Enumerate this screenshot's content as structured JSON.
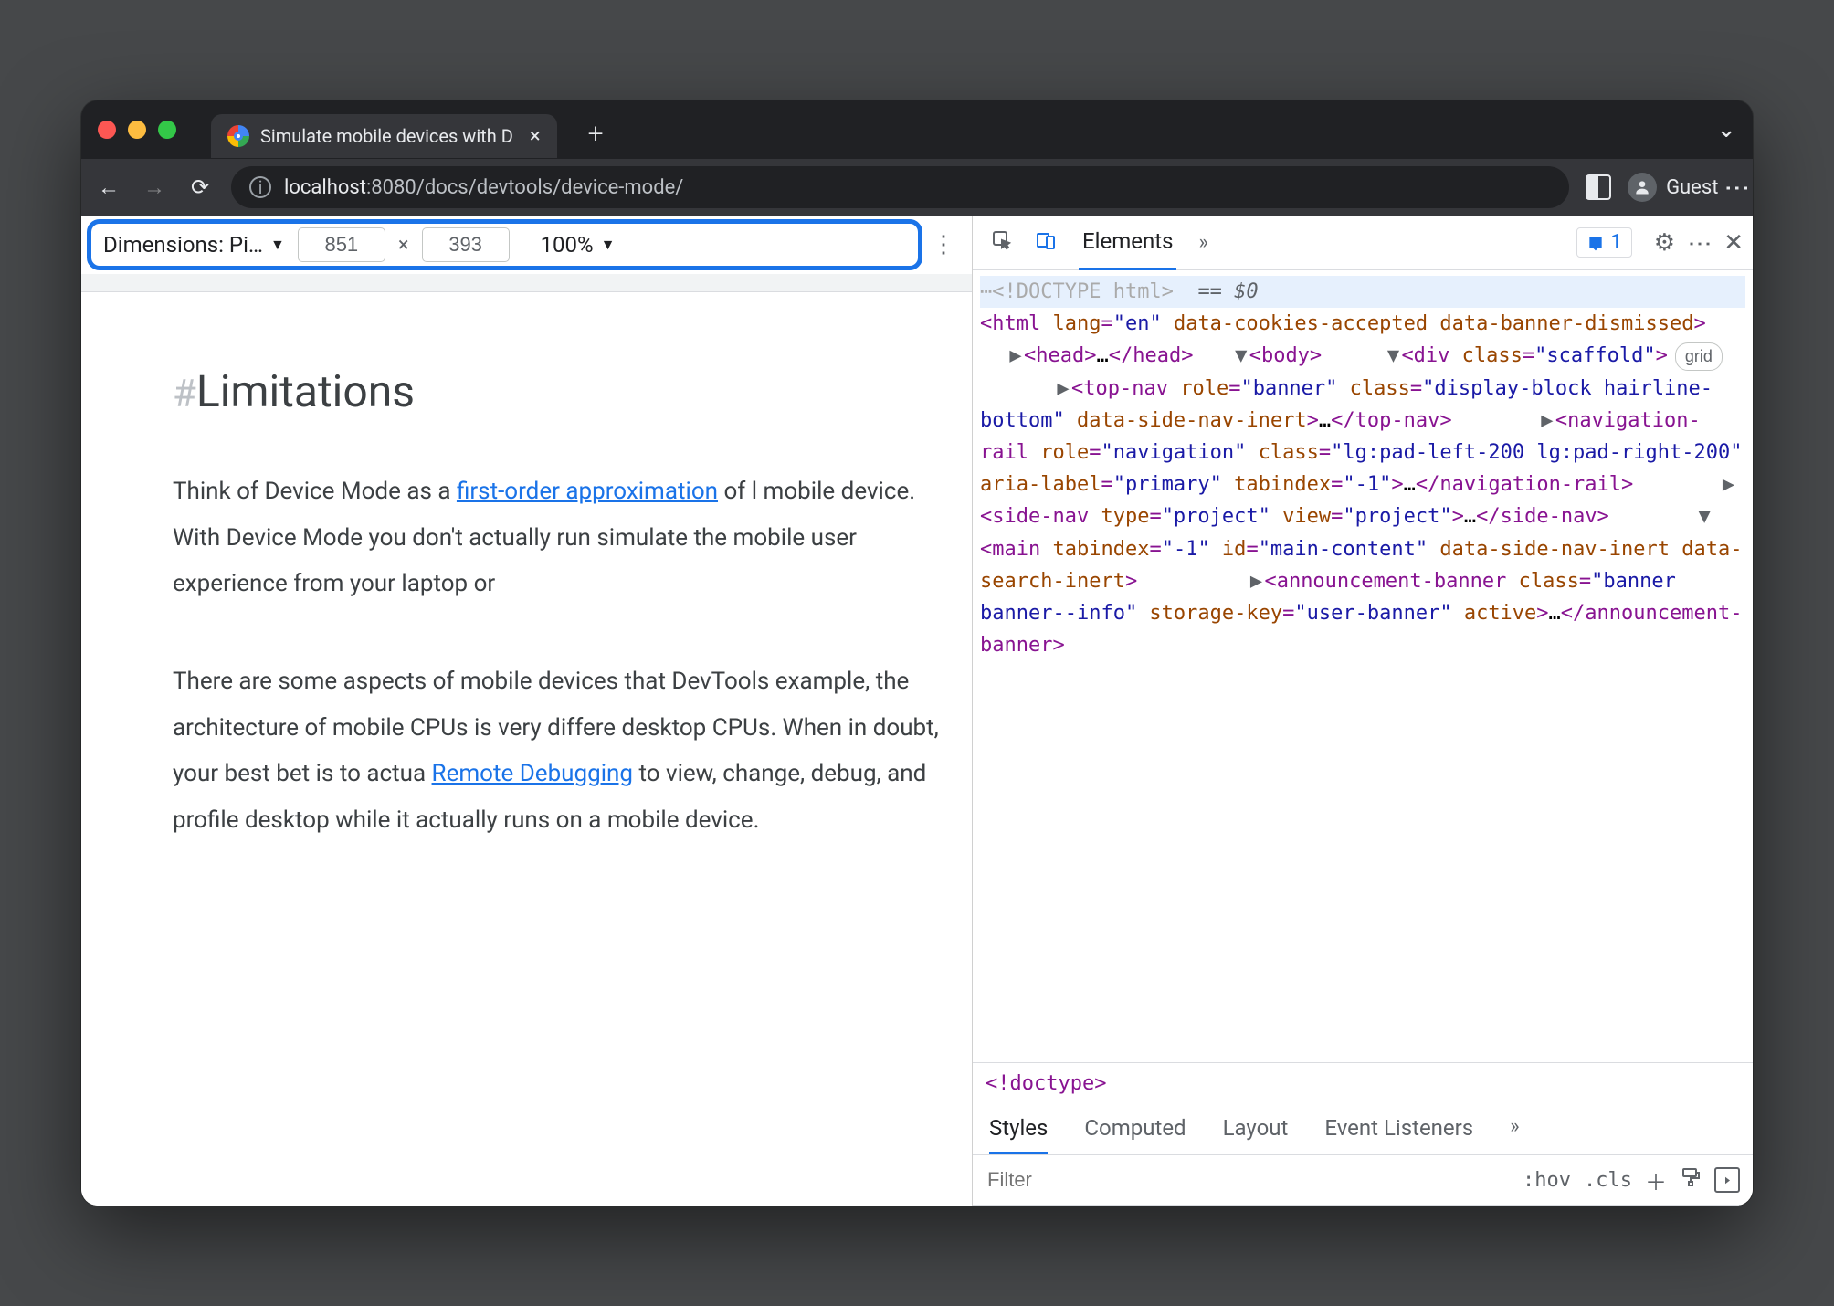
{
  "titlebar": {
    "tab_title": "Simulate mobile devices with D",
    "tab_close": "×",
    "new_tab": "+",
    "chevron": "⌄"
  },
  "addrbar": {
    "back": "←",
    "forward": "→",
    "reload": "⟳",
    "url_host": "localhost",
    "url_port_path": ":8080/docs/devtools/device-mode/",
    "guest_label": "Guest",
    "kebab": "⋮"
  },
  "device_toolbar": {
    "dimensions_label": "Dimensions: Pi…",
    "width": "851",
    "times": "×",
    "height": "393",
    "zoom": "100%",
    "kebab": "⋮"
  },
  "page": {
    "hash": "#",
    "heading": "Limitations",
    "p1_a": "Think of Device Mode as a ",
    "p1_link": "first-order approximation",
    "p1_b": " of l mobile device. With Device Mode you don't actually run simulate the mobile user experience from your laptop or",
    "p2_a": "There are some aspects of mobile devices that DevTools example, the architecture of mobile CPUs is very differe desktop CPUs. When in doubt, your best bet is to actua ",
    "p2_link": "Remote Debugging",
    "p2_b": " to view, change, debug, and profile desktop while it actually runs on a mobile device."
  },
  "devtools": {
    "elements_tab": "Elements",
    "more": "»",
    "issues_count": "1",
    "gear": "⚙",
    "kebab": "⋮",
    "close": "✕",
    "dom": {
      "l0": "<!DOCTYPE html>",
      "eq": "== $0",
      "l1_a": "<html ",
      "l1_attr1": "lang",
      "l1_val1": "\"en\"",
      "l1_attr2": " data-cookies-accepted data-banner-dismissed",
      "l1_c": ">",
      "l2_a": "<head>",
      "l2_b": "…",
      "l2_c": "</head>",
      "l3": "<body>",
      "l4_a": "<div ",
      "l4_attr": "class",
      "l4_val": "\"scaffold\"",
      "l4_c": ">",
      "l4_badge": "grid",
      "l5_a": "<top-nav ",
      "l5_attr1": "role",
      "l5_val1": "\"banner\"",
      "l5_attr2": " class",
      "l5_val2": "\"display-block hairline-bottom\"",
      "l5_attr3": " data-side-nav-inert",
      "l5_c": ">",
      "l5_d": "…",
      "l5_e": "</top-nav>",
      "l6_a": "<navigation-rail ",
      "l6_attr1": "role",
      "l6_val1": "\"navigation\"",
      "l6_attr2": " class",
      "l6_val2": "\"lg:pad-left-200 lg:pad-right-200\"",
      "l6_attr3": " aria-label",
      "l6_val3": "\"primary\"",
      "l6_attr4": " tabindex",
      "l6_val4": "\"-1\"",
      "l6_c": ">",
      "l6_d": "…",
      "l6_e": "</navigation-rail>",
      "l7_a": "<side-nav ",
      "l7_attr1": "type",
      "l7_val1": "\"project\"",
      "l7_attr2": " view",
      "l7_val2": "\"project\"",
      "l7_c": ">",
      "l7_d": "…",
      "l7_e": "</side-nav>",
      "l8_a": "<main ",
      "l8_attr1": "tabindex",
      "l8_val1": "\"-1\"",
      "l8_attr2": " id",
      "l8_val2": "\"main-content\"",
      "l8_attr3": " data-side-nav-inert data-search-inert",
      "l8_c": ">",
      "l9_a": "<announcement-banner ",
      "l9_attr1": "class",
      "l9_val1": "\"banner banner--info\"",
      "l9_attr2": " storage-key",
      "l9_val2": "\"user-banner\"",
      "l9_attr3": " active",
      "l9_c": ">",
      "l9_d": "…",
      "l9_e": "</announcement-banner>"
    },
    "breadcrumb": "<!doctype>",
    "styles_tabs": {
      "styles": "Styles",
      "computed": "Computed",
      "layout": "Layout",
      "listeners": "Event Listeners",
      "more": "»"
    },
    "filter": {
      "placeholder": "Filter",
      "hov": ":hov",
      "cls": ".cls",
      "plus": "＋"
    }
  }
}
